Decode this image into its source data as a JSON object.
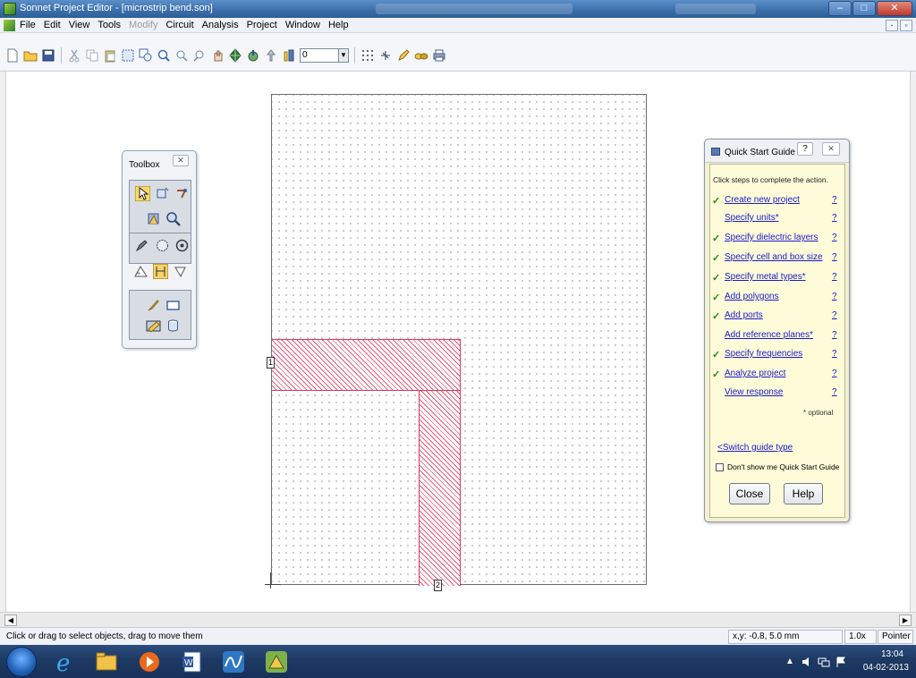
{
  "window": {
    "title": "Sonnet Project Editor - [microstrip bend.son]",
    "minimize": "‒",
    "maximize": "□",
    "close": "✕"
  },
  "menu": {
    "items": [
      {
        "label": "File",
        "enabled": true
      },
      {
        "label": "Edit",
        "enabled": true
      },
      {
        "label": "View",
        "enabled": true
      },
      {
        "label": "Tools",
        "enabled": true
      },
      {
        "label": "Modify",
        "enabled": false
      },
      {
        "label": "Circuit",
        "enabled": true
      },
      {
        "label": "Analysis",
        "enabled": true
      },
      {
        "label": "Project",
        "enabled": true
      },
      {
        "label": "Window",
        "enabled": true
      },
      {
        "label": "Help",
        "enabled": true
      }
    ],
    "mdi_min": "-",
    "mdi_restore": "▫"
  },
  "toolbar": {
    "level_value": "0",
    "combo_arrow": "▼"
  },
  "toolbox": {
    "title": "Toolbox",
    "close": "✕"
  },
  "canvas": {
    "port1_label": "1",
    "port2_label": "2"
  },
  "quick_start": {
    "title": "Quick Start Guide",
    "help_glyph": "?",
    "close_glyph": "✕",
    "instruction": "Click steps to complete the action.",
    "steps": [
      {
        "label": "Create new project",
        "done": true,
        "help": "?"
      },
      {
        "label": "Specify units*",
        "done": false,
        "help": "?"
      },
      {
        "label": "Specify dielectric layers",
        "done": true,
        "help": "?"
      },
      {
        "label": "Specify cell and box size",
        "done": true,
        "help": "?"
      },
      {
        "label": "Specify metal types*",
        "done": true,
        "help": "?"
      },
      {
        "label": "Add polygons",
        "done": true,
        "help": "?"
      },
      {
        "label": "Add ports",
        "done": true,
        "help": "?"
      },
      {
        "label": "Add reference planes*",
        "done": false,
        "help": "?"
      },
      {
        "label": "Specify frequencies",
        "done": true,
        "help": "?"
      },
      {
        "label": "Analyze project",
        "done": true,
        "help": "?"
      },
      {
        "label": "View response",
        "done": false,
        "help": "?"
      }
    ],
    "checkmark": "✓",
    "optional_note": "* optional",
    "switch_link": "<Switch guide type",
    "dont_show_label": "Don't show me Quick Start Guide",
    "close_button": "Close",
    "help_button": "Help"
  },
  "scrollbar": {
    "left_arrow": "◀",
    "right_arrow": "▶"
  },
  "status": {
    "message": "Click or drag to select objects, drag to move them",
    "coords": "x,y: -0.8, 5.0 mm",
    "zoom": "1.0x",
    "mode": "Pointer"
  },
  "taskbar": {
    "time": "13:04",
    "date": "04-02-2013",
    "tray_arrow": "▲"
  },
  "colors": {
    "metal_hatch": "#e35a78",
    "link": "#1a1acf",
    "check": "#1e8a1e",
    "guide_bg": "#fdfbd8"
  }
}
